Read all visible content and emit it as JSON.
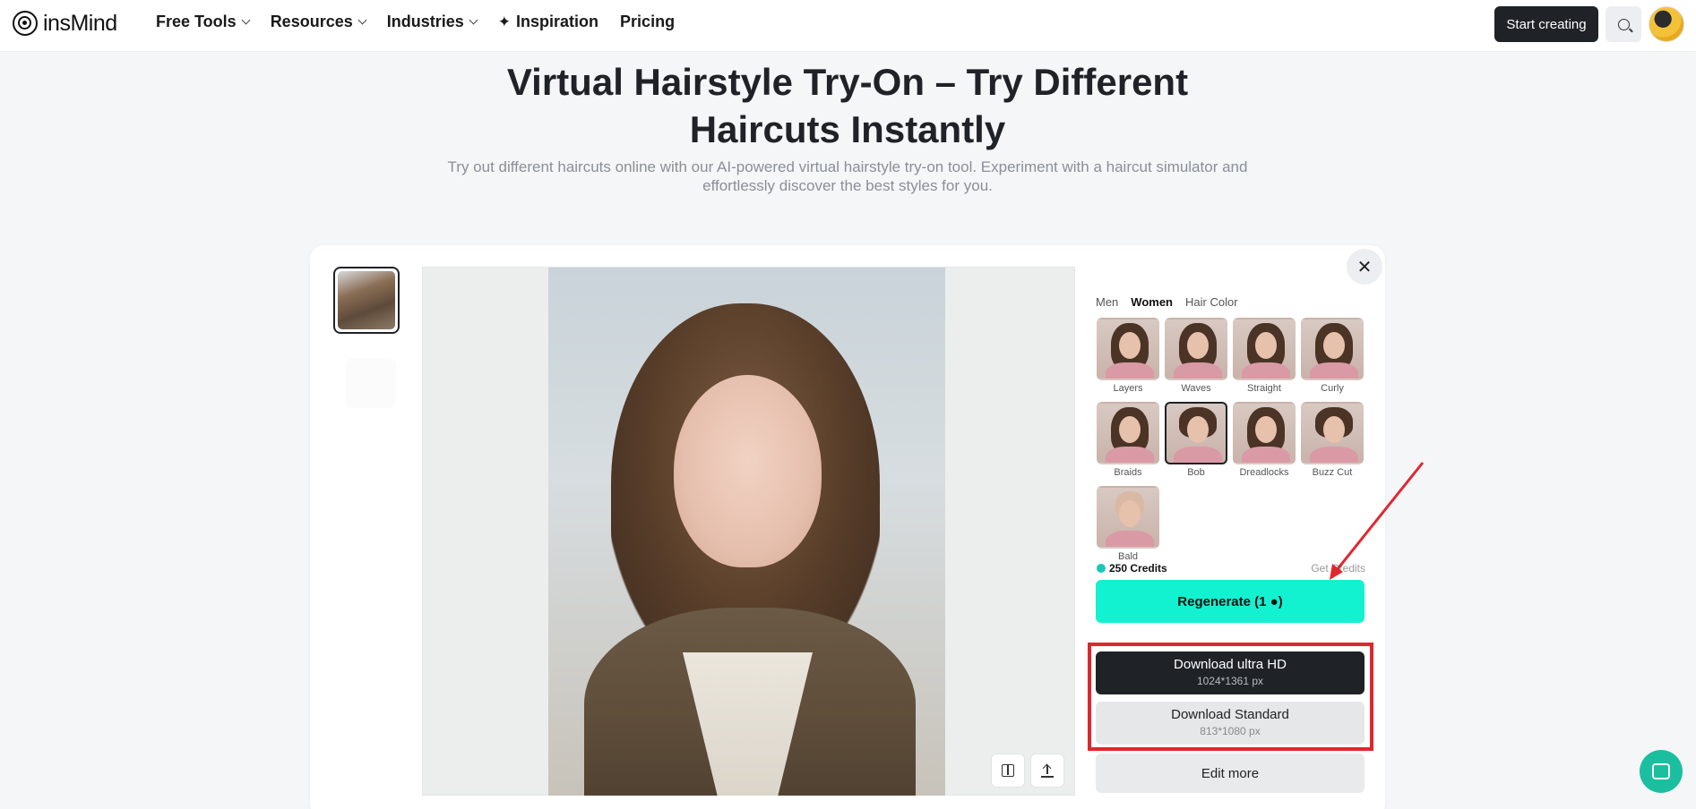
{
  "brand": {
    "name": "insMind"
  },
  "nav": {
    "items": [
      {
        "label": "Free Tools",
        "has_dropdown": true
      },
      {
        "label": "Resources",
        "has_dropdown": true
      },
      {
        "label": "Industries",
        "has_dropdown": true
      },
      {
        "label": "Inspiration",
        "icon": "sparkle-icon",
        "has_dropdown": false
      },
      {
        "label": "Pricing",
        "has_dropdown": false
      }
    ],
    "start_button": "Start creating",
    "search_icon": "search-icon"
  },
  "hero": {
    "title_line1": "Virtual Hairstyle Try-On – Try Different",
    "title_line2": "Haircuts Instantly",
    "subtitle_line1": "Try out different haircuts online with our AI-powered virtual hairstyle try-on tool. Experiment with a haircut simulator and",
    "subtitle_line2": "effortlessly discover the best styles for you."
  },
  "panel": {
    "tabs": [
      {
        "label": "Men",
        "active": false
      },
      {
        "label": "Women",
        "active": true
      },
      {
        "label": "Hair Color",
        "active": false
      }
    ],
    "styles": [
      {
        "label": "Layers",
        "selected": false
      },
      {
        "label": "Waves",
        "selected": false
      },
      {
        "label": "Straight",
        "selected": false
      },
      {
        "label": "Curly",
        "selected": false
      },
      {
        "label": "Braids",
        "selected": false
      },
      {
        "label": "Bob",
        "selected": true
      },
      {
        "label": "Dreadlocks",
        "selected": false
      },
      {
        "label": "Buzz Cut",
        "selected": false
      },
      {
        "label": "Bald",
        "selected": false
      }
    ],
    "credits": "250 Credits",
    "get_credits": "Get Credits",
    "regenerate": "Regenerate (1 ●)",
    "download_hd": {
      "label": "Download ultra HD",
      "size": "1024*1361 px"
    },
    "download_std": {
      "label": "Download Standard",
      "size": "813*1080 px"
    },
    "edit_more": "Edit more"
  },
  "colors": {
    "accent": "#12f2d0",
    "dark": "#1f2226",
    "highlight": "#e0262f"
  }
}
